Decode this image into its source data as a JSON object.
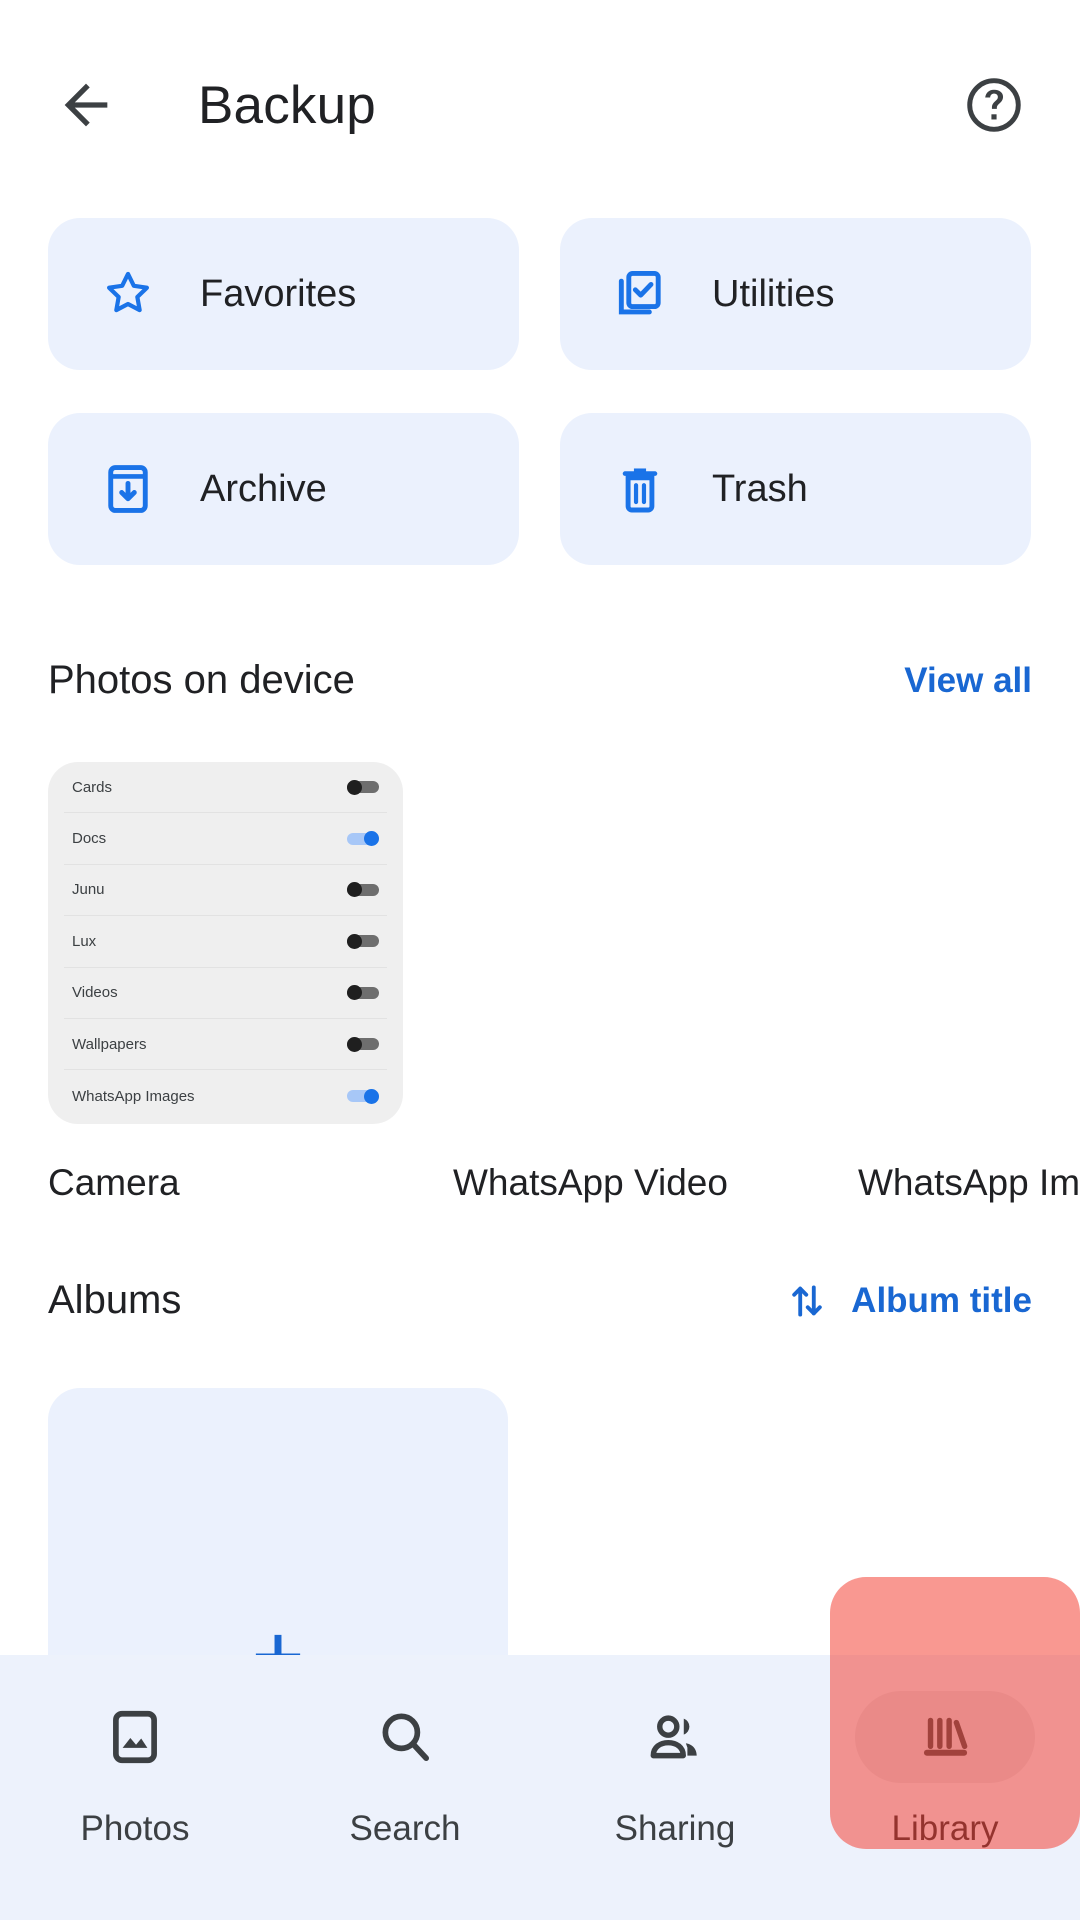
{
  "appbar": {
    "back_icon": "arrow-left-icon",
    "title": "Backup",
    "help_icon": "help-circle-icon"
  },
  "shortcuts": [
    {
      "label": "Favorites",
      "icon": "star-outline-icon"
    },
    {
      "label": "Utilities",
      "icon": "utilities-checkbox-icon"
    },
    {
      "label": "Archive",
      "icon": "archive-box-icon"
    },
    {
      "label": "Trash",
      "icon": "trash-can-icon"
    }
  ],
  "photos_on_device": {
    "title": "Photos on device",
    "view_all_label": "View all",
    "items": [
      {
        "caption": "Camera",
        "thumbnail_type": "settings-toggle-list",
        "toggles": [
          {
            "label": "Cards",
            "on": false
          },
          {
            "label": "Docs",
            "on": true
          },
          {
            "label": "Junu",
            "on": false
          },
          {
            "label": "Lux",
            "on": false
          },
          {
            "label": "Videos",
            "on": false
          },
          {
            "label": "Wallpapers",
            "on": false
          },
          {
            "label": "WhatsApp Images",
            "on": true
          }
        ]
      },
      {
        "caption": "WhatsApp Video",
        "thumbnail_type": "blank",
        "toggles": []
      },
      {
        "caption": "WhatsApp Im",
        "thumbnail_type": "blank",
        "toggles": []
      }
    ]
  },
  "albums": {
    "title": "Albums",
    "sort_icon": "sort-arrows-icon",
    "sort_label": "Album title",
    "create_icon": "plus-icon"
  },
  "bottom_nav": {
    "items": [
      {
        "label": "Photos",
        "icon": "photo-frame-icon",
        "active": false
      },
      {
        "label": "Search",
        "icon": "magnifier-icon",
        "active": false
      },
      {
        "label": "Sharing",
        "icon": "people-icon",
        "active": false
      },
      {
        "label": "Library",
        "icon": "library-books-icon",
        "active": true
      }
    ]
  },
  "colors": {
    "accent_blue": "#1967D2",
    "card_blue": "#EBF1FD",
    "nav_bg": "#EDF2FC",
    "text_primary": "#202124",
    "highlight_red": "#F44336",
    "toggle_on": "#1A73E8",
    "toggle_off": "#1F1F1F"
  }
}
